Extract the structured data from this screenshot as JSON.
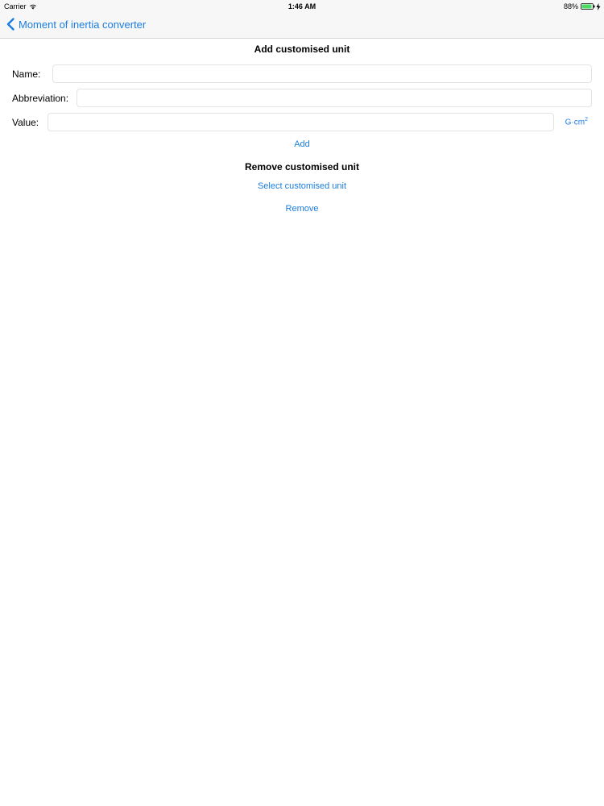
{
  "status_bar": {
    "carrier": "Carrier",
    "time": "1:46 AM",
    "battery_percent": "88%"
  },
  "nav": {
    "back_label": "Moment of inertia converter",
    "back_icon": "chevron-left-icon"
  },
  "add_section": {
    "title": "Add customised unit",
    "name_label": "Name:",
    "name_value": "",
    "abbreviation_label": "Abbreviation:",
    "abbreviation_value": "",
    "value_label": "Value:",
    "value_value": "",
    "unit_base": "G·cm",
    "unit_exponent": "2",
    "add_button": "Add"
  },
  "remove_section": {
    "title": "Remove customised unit",
    "select_button": "Select customised unit",
    "remove_button": "Remove"
  },
  "colors": {
    "accent": "#1a7ddf",
    "battery_fill": "#4cd964",
    "bar_background": "#f7f7f7"
  }
}
